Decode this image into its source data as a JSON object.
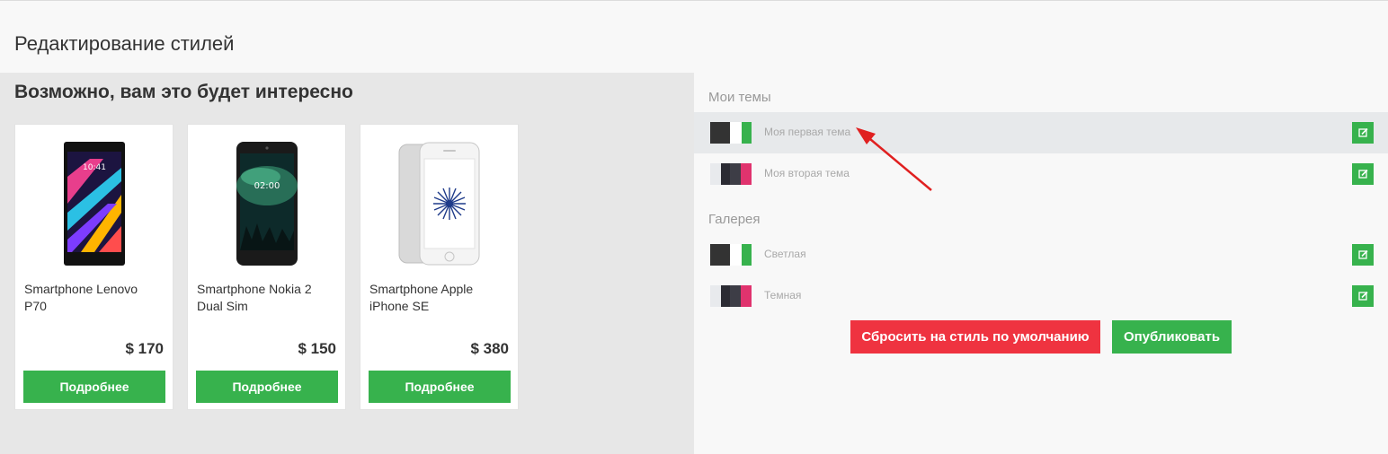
{
  "page": {
    "title": "Редактирование стилей"
  },
  "preview": {
    "heading": "Возможно, вам это будет интересно",
    "products": [
      {
        "name": "Smartphone Lenovo P70",
        "price": "$ 170",
        "button": "Подробнее",
        "image": "phone-lenovo-image"
      },
      {
        "name": "Smartphone Nokia 2 Dual Sim",
        "price": "$ 150",
        "button": "Подробнее",
        "image": "phone-nokia-image"
      },
      {
        "name": "Smartphone Apple iPhone SE",
        "price": "$ 380",
        "button": "Подробнее",
        "image": "phone-iphone-image"
      }
    ]
  },
  "themes": {
    "my_label": "Мои темы",
    "my": [
      {
        "name": "Моя первая тема",
        "active": true,
        "swatch": [
          "#333333",
          "#ffffff",
          "#37b24d"
        ],
        "edit_icon": "edit-icon"
      },
      {
        "name": "Моя вторая тема",
        "active": false,
        "swatch": [
          "#e8eaed",
          "#2b2b33",
          "#3d3d46",
          "#e0336e"
        ],
        "edit_icon": "edit-icon"
      }
    ],
    "gallery_label": "Галерея",
    "gallery": [
      {
        "name": "Светлая",
        "swatch": [
          "#333333",
          "#ffffff",
          "#37b24d"
        ],
        "edit_icon": "edit-icon"
      },
      {
        "name": "Темная",
        "swatch": [
          "#e8eaed",
          "#2b2b33",
          "#3d3d46",
          "#e0336e"
        ],
        "edit_icon": "edit-icon"
      }
    ]
  },
  "actions": {
    "reset": "Сбросить на стиль по умолчанию",
    "publish": "Опубликовать"
  },
  "colors": {
    "accent_green": "#37b24d",
    "danger_red": "#ef3340",
    "annotation_arrow": "#e02020"
  }
}
